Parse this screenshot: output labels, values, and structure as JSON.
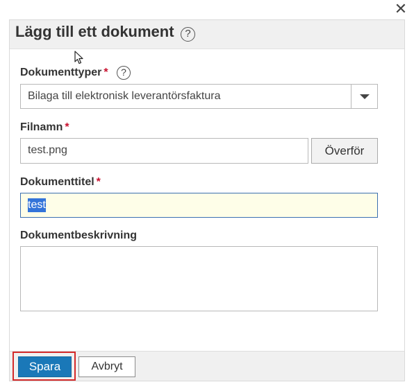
{
  "dialog": {
    "title": "Lägg till ett dokument",
    "close_glyph": "✕",
    "help_glyph": "?"
  },
  "form": {
    "document_type": {
      "label": "Dokumenttyper",
      "required_marker": "*",
      "help_glyph": "?",
      "selected_value": "Bilaga till elektronisk leverantörsfaktura"
    },
    "file_name": {
      "label": "Filnamn",
      "required_marker": "*",
      "value": "test.png",
      "upload_label": "Överför"
    },
    "document_title": {
      "label": "Dokumenttitel",
      "required_marker": "*",
      "value": "test"
    },
    "document_description": {
      "label": "Dokumentbeskrivning",
      "value": ""
    }
  },
  "footer": {
    "save_label": "Spara",
    "cancel_label": "Avbryt"
  },
  "colors": {
    "primary_button": "#1a78b8",
    "required": "#c8102e",
    "highlight_border": "#d42a2a",
    "focused_input_bg": "#fefee8",
    "selection": "#3374d9"
  },
  "icons": {
    "close": "close-icon",
    "help": "help-icon",
    "dropdown": "chevron-down-icon",
    "cursor": "mouse-pointer-icon"
  }
}
